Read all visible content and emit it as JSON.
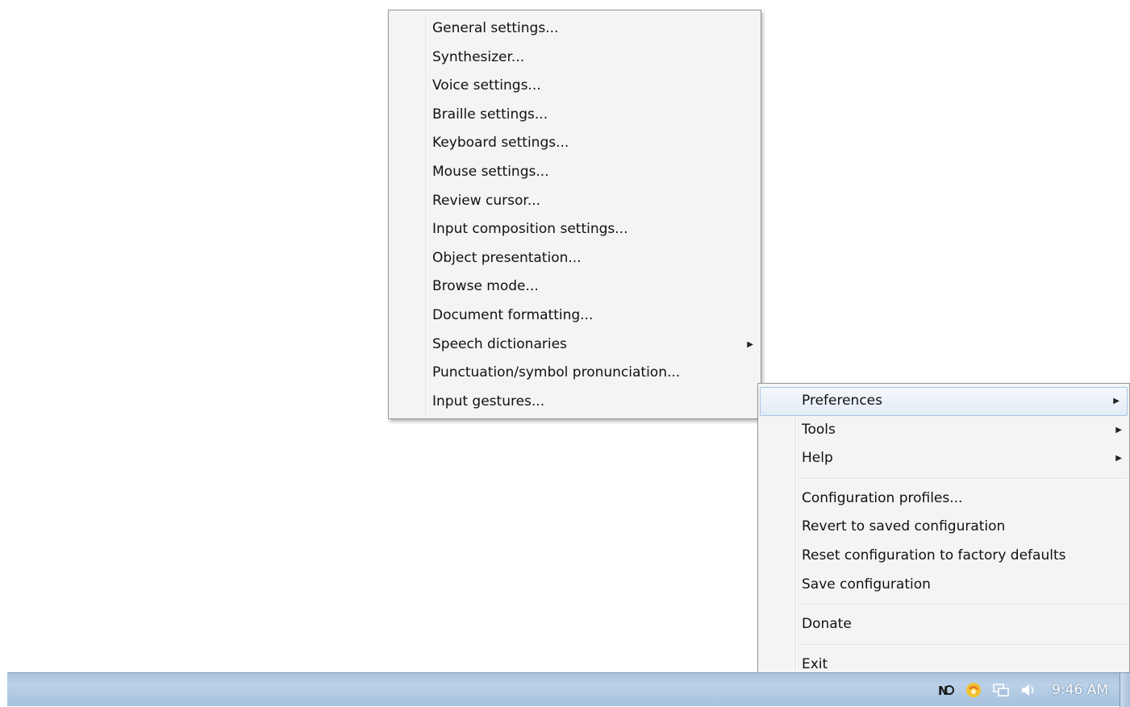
{
  "preferences_menu": {
    "items": [
      {
        "label": "General settings..."
      },
      {
        "label": "Synthesizer..."
      },
      {
        "label": "Voice settings..."
      },
      {
        "label": "Braille settings..."
      },
      {
        "label": "Keyboard settings..."
      },
      {
        "label": "Mouse settings..."
      },
      {
        "label": "Review cursor..."
      },
      {
        "label": "Input composition settings..."
      },
      {
        "label": "Object presentation..."
      },
      {
        "label": "Browse mode..."
      },
      {
        "label": "Document formatting..."
      },
      {
        "label": "Speech dictionaries",
        "submenu_arrow": "▶"
      },
      {
        "label": "Punctuation/symbol pronunciation..."
      },
      {
        "label": "Input gestures..."
      }
    ]
  },
  "main_menu": {
    "group1": [
      {
        "label": "Preferences",
        "submenu_arrow": "▶",
        "selected": true
      },
      {
        "label": "Tools",
        "submenu_arrow": "▶"
      },
      {
        "label": "Help",
        "submenu_arrow": "▶"
      }
    ],
    "group2": [
      {
        "label": "Configuration profiles..."
      },
      {
        "label": "Revert to saved configuration"
      },
      {
        "label": "Reset configuration to factory defaults"
      },
      {
        "label": "Save configuration"
      }
    ],
    "group3": [
      {
        "label": "Donate"
      }
    ],
    "group4": [
      {
        "label": "Exit"
      }
    ]
  },
  "taskbar": {
    "tray_icons": [
      "nvda-icon",
      "java-icon",
      "network-icon",
      "volume-icon"
    ],
    "clock": "9:46 AM"
  },
  "colors": {
    "menu_background": "#f4f4f4",
    "menu_border": "#979797",
    "selection_border": "#a8c4e3",
    "taskbar": "#b3cbe4"
  }
}
